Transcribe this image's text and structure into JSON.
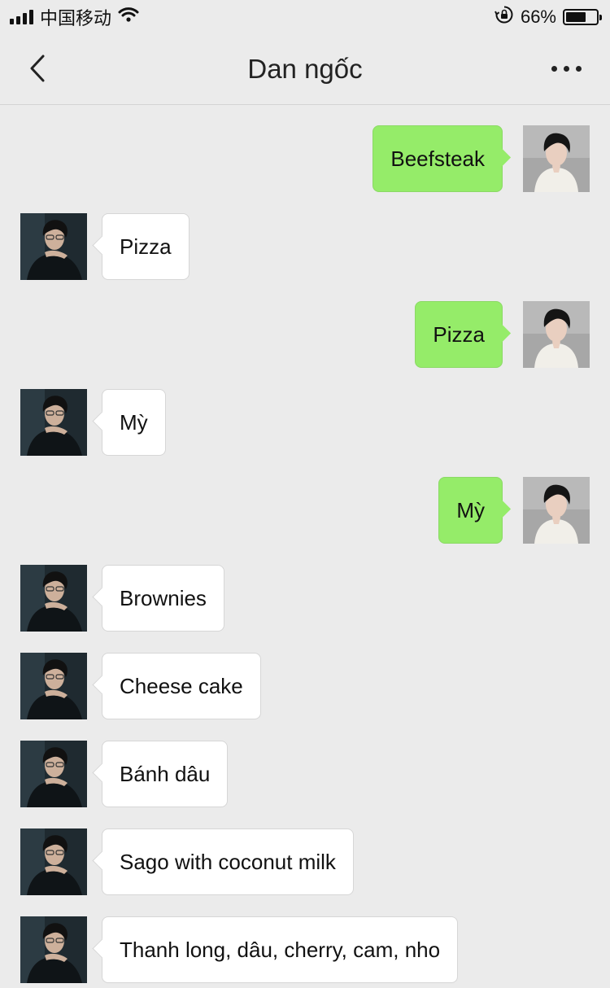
{
  "status_bar": {
    "carrier": "中国移动",
    "battery_percent": "66%",
    "battery_level": 0.66,
    "icons": [
      "signal-icon",
      "wifi-icon",
      "rotation-lock-icon",
      "battery-icon"
    ]
  },
  "nav": {
    "title": "Dan ngốc",
    "back_icon": "chevron-left-icon",
    "more_icon": "more-icon"
  },
  "colors": {
    "background": "#ebebeb",
    "sent_bubble": "#95ec69",
    "received_bubble": "#ffffff"
  },
  "messages": [
    {
      "side": "right",
      "text": "Beefsteak"
    },
    {
      "side": "left",
      "text": "Pizza"
    },
    {
      "side": "right",
      "text": "Pizza"
    },
    {
      "side": "left",
      "text": "Mỳ"
    },
    {
      "side": "right",
      "text": "Mỳ"
    },
    {
      "side": "left",
      "text": "Brownies"
    },
    {
      "side": "left",
      "text": "Cheese cake"
    },
    {
      "side": "left",
      "text": "Bánh dâu"
    },
    {
      "side": "left",
      "text": "Sago with coconut milk"
    },
    {
      "side": "left",
      "text": "Thanh long, dâu, cherry, cam, nho"
    }
  ]
}
